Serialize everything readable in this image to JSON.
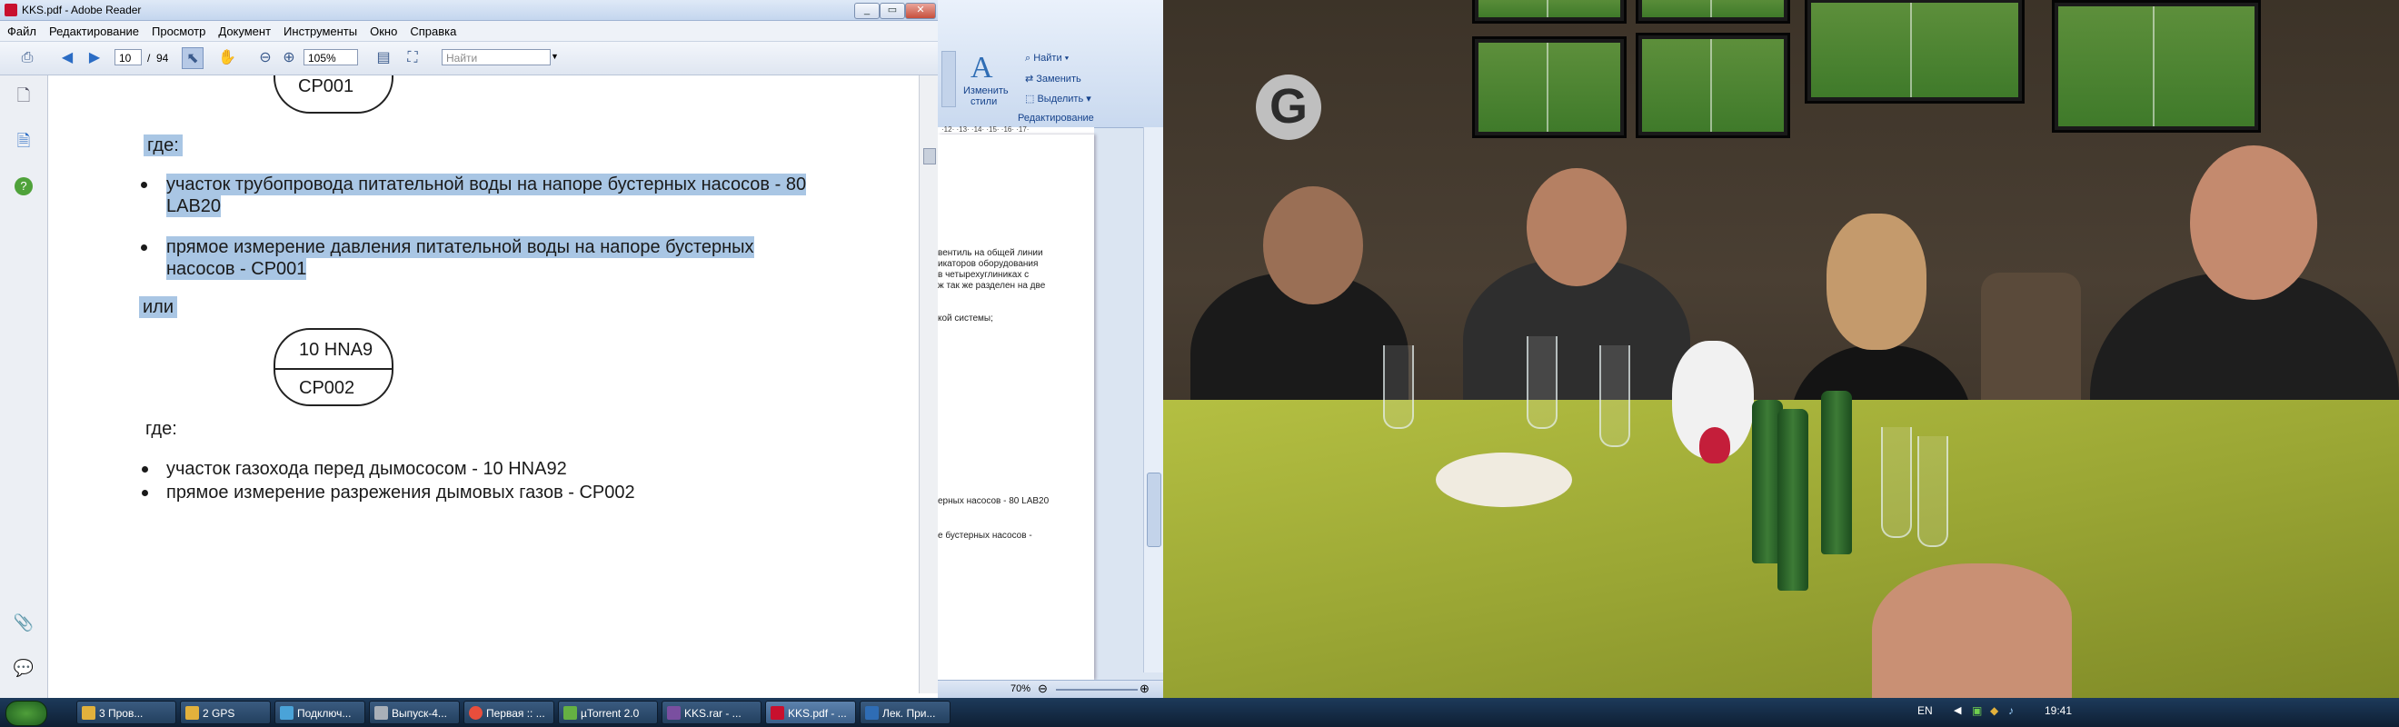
{
  "reader": {
    "title": "KKS.pdf - Adobe Reader",
    "menu": [
      "Файл",
      "Редактирование",
      "Просмотр",
      "Документ",
      "Инструменты",
      "Окно",
      "Справка"
    ],
    "toolbar": {
      "page_current": "10",
      "page_separator": "/",
      "page_total": "94",
      "zoom": "105%",
      "search_placeholder": "Найти"
    },
    "window_buttons": {
      "minimize": "_",
      "maximize": "▭",
      "close": "✕"
    },
    "document": {
      "top_box_label": "CP001",
      "where_1": "где:",
      "bullets_1": [
        {
          "line1": "участок трубопровода питательной воды на напоре бустерных насосов - 80",
          "line2": "LAB20"
        },
        {
          "line1": "прямое измерение давления питательной воды на напоре бустерных",
          "line2": "насосов - CP001"
        }
      ],
      "or": "или",
      "box_top": "10 HNA9",
      "box_bottom": "CP002",
      "where_2": "где:",
      "bullets_2": [
        "участок газохода перед дымососом - 10 HNA92",
        "прямое измерение разрежения дымовых газов - CP002"
      ]
    }
  },
  "word": {
    "ribbon": {
      "change_styles_line1": "Изменить",
      "change_styles_line2": "стили",
      "find": "Найти",
      "replace": "Заменить",
      "select": "Выделить",
      "group_label": "Редактирование"
    },
    "ruler": "·12· ·13· ·14· ·15· ·16· ·17·",
    "text_lines": [
      "вентиль на общей линии",
      "икаторов оборудования",
      "в четырехуглиниках с",
      "ж так же разделен на две",
      "кой системы;",
      "ерных насосов - 80 LAB20",
      "е бустерных насосов -"
    ],
    "zoom": "70%"
  },
  "video": {
    "logo": "G"
  },
  "taskbar": {
    "items": [
      {
        "label": "3 Пров...",
        "color": "#e2b13c"
      },
      {
        "label": "2 GPS",
        "color": "#e2b13c"
      },
      {
        "label": "Подключ...",
        "color": "#4aa3d8"
      },
      {
        "label": "Выпуск-4...",
        "color": "#a9b0b8"
      },
      {
        "label": "Первая :: ...",
        "color": "#e94e3c"
      },
      {
        "label": "µTorrent 2.0",
        "color": "#65b043"
      },
      {
        "label": "KKS.rar - ...",
        "color": "#7a4fa0"
      },
      {
        "label": "KKS.pdf - ...",
        "color": "#c8102e"
      },
      {
        "label": "Лек. При...",
        "color": "#2f6db5"
      }
    ],
    "active_index": 7,
    "language": "EN",
    "clock": "19:41"
  }
}
